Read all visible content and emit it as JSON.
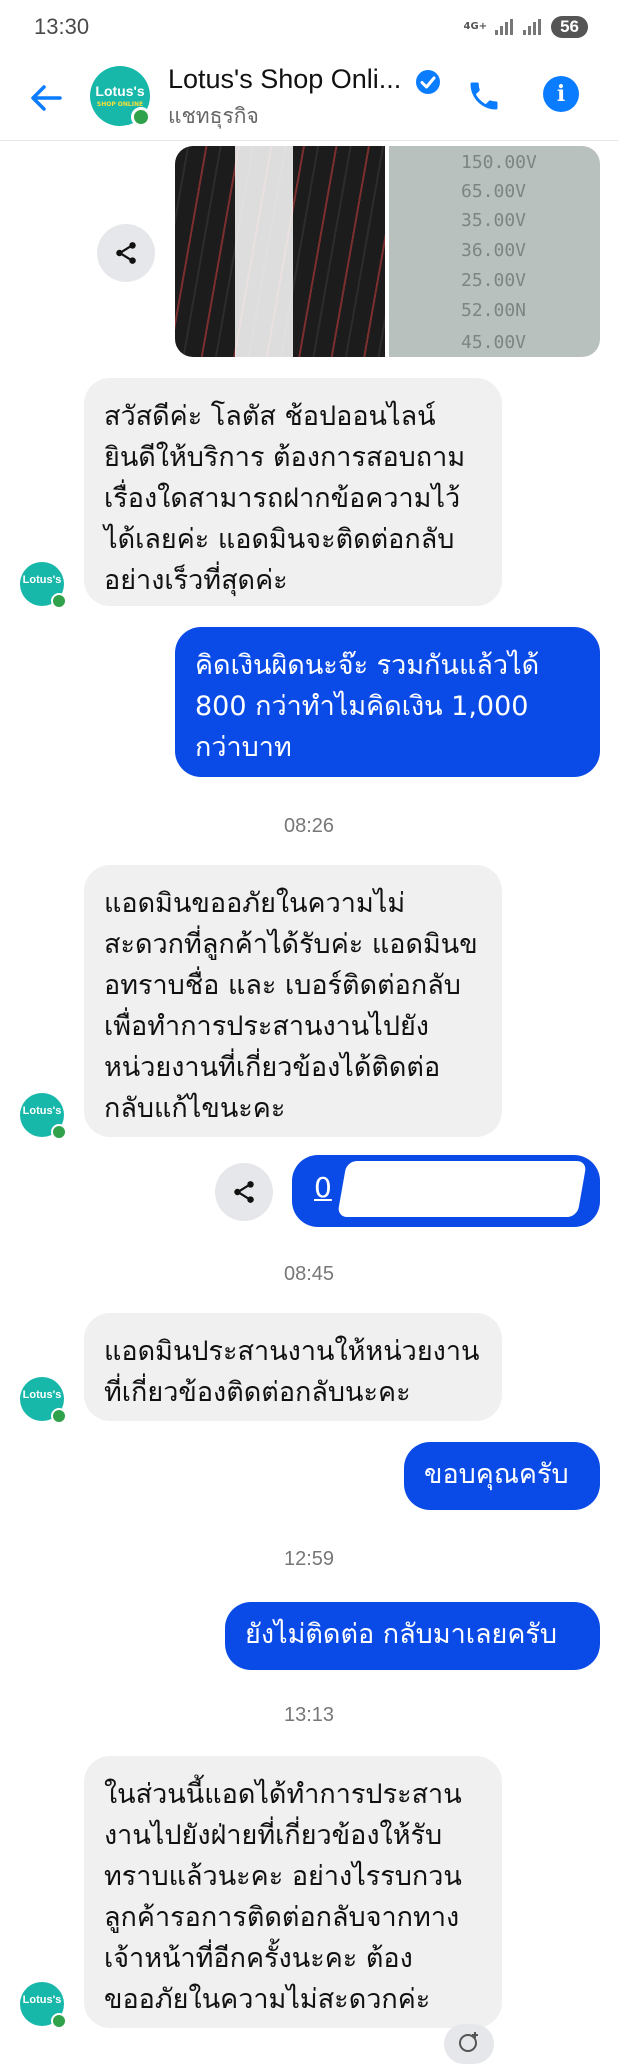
{
  "status_bar": {
    "time": "13:30",
    "network": "4G+",
    "battery": "56"
  },
  "header": {
    "title": "Lotus's Shop Onli...",
    "subtitle": "แชทธุรกิจ",
    "avatar_text": "Lotus's",
    "avatar_subtext": "SHOP ONLINE"
  },
  "photo_values": [
    "150.00V",
    "65.00V",
    "35.00V",
    "36.00V",
    "25.00V",
    "52.00N",
    "45.00V"
  ],
  "messages": {
    "m1": "สวัสดีค่ะ โลตัส ช้อปออนไลน์ ยินดีให้บริการ ต้องการสอบถามเรื่องใดสามารถฝากข้อความไว้ได้เลยค่ะ แอดมินจะติดต่อกลับอย่างเร็วที่สุดค่ะ",
    "m2": "คิดเงินผิดนะจ๊ะ รวมกันแล้วได้ 800 กว่าทำไมคิดเงิน 1,000 กว่าบาท",
    "t1": "08:26",
    "m3": "แอดมินขออภัยในความไม่สะดวกที่ลูกค้าได้รับค่ะ แอดมินขอทราบชื่อ และ เบอร์ติดต่อกลับเพื่อทำการประสานงานไปยังหน่วยงานที่เกี่ยวข้องได้ติดต่อกลับแก้ไขนะคะ",
    "m4": "0",
    "t2": "08:45",
    "m5": "แอดมินประสานงานให้หน่วยงานที่เกี่ยวข้องติดต่อกลับนะคะ",
    "m6": "ขอบคุณครับ",
    "t3": "12:59",
    "m7": "ยังไม่ติดต่อ กลับมาเลยครับ",
    "t4": "13:13",
    "m8": "ในส่วนนี้แอดได้ทำการประสานงานไปยังฝ่ายที่เกี่ยวข้องให้รับทราบแล้วนะคะ อย่างไรรบกวนลูกค้ารอการติดต่อกลับจากทางเจ้าหน้าที่อีกครั้งนะคะ ต้องขออภัยในความไม่สะดวกค่ะ"
  },
  "colors": {
    "outgoing": "#0a4be8",
    "incoming": "#f0f0f0",
    "accent": "#0a7cff",
    "brand": "#17b7a9",
    "online": "#31a24c"
  },
  "icons": [
    "back-arrow-icon",
    "verified-icon",
    "phone-icon",
    "info-icon",
    "share-icon",
    "add-reaction-icon"
  ]
}
